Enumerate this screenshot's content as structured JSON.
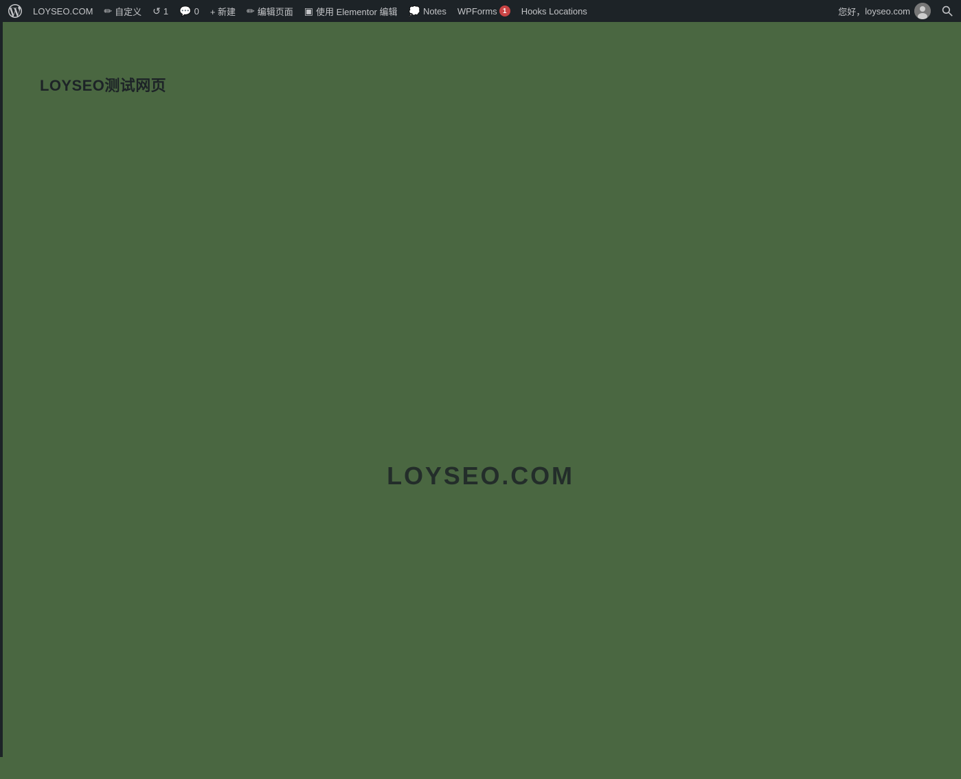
{
  "adminbar": {
    "wp_logo": "W",
    "site_name": "LOYSEO.COM",
    "customize_label": "自定义",
    "updates_count": "1",
    "comments_label": "",
    "comments_count": "0",
    "new_label": "+ 新建",
    "edit_page_label": "编辑页面",
    "elementor_label": "使用 Elementor 编辑",
    "notes_label": "Notes",
    "wpforms_label": "WPForms",
    "wpforms_badge": "1",
    "hooks_label": "Hooks Locations",
    "greeting": "您好，",
    "username": "loyseo.com",
    "search_icon": "🔍"
  },
  "page": {
    "title": "LOYSEO测试网页",
    "watermark": "LOYSEO.COM",
    "bg_color": "#4a6741"
  }
}
